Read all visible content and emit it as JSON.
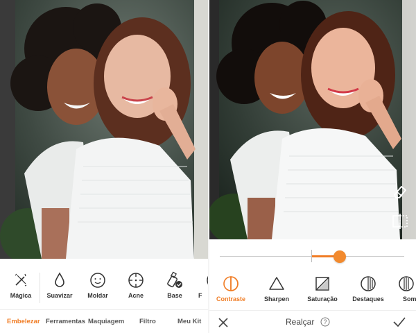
{
  "left_panel": {
    "tools": [
      {
        "label": "Mágica",
        "icon": "magic-wand-icon"
      },
      {
        "label": "Suavizar",
        "icon": "drop-icon"
      },
      {
        "label": "Moldar",
        "icon": "face-icon"
      },
      {
        "label": "Acne",
        "icon": "crosshair-icon"
      },
      {
        "label": "Base",
        "icon": "foundation-bottle-icon"
      },
      {
        "label": "F",
        "icon": "partial-tool-icon"
      }
    ],
    "nav_tabs": [
      {
        "label": "Embelezar",
        "active": true
      },
      {
        "label": "Ferramentas",
        "active": false
      },
      {
        "label": "Maquiagem",
        "active": false
      },
      {
        "label": "Filtro",
        "active": false
      },
      {
        "label": "Meu Kit",
        "active": false
      }
    ]
  },
  "right_panel": {
    "slider": {
      "min": -100,
      "max": 100,
      "value": 30
    },
    "adjustments": [
      {
        "label": "Contraste",
        "icon": "contrast-icon",
        "active": true
      },
      {
        "label": "Sharpen",
        "icon": "triangle-icon",
        "active": false
      },
      {
        "label": "Saturação",
        "icon": "saturation-icon",
        "active": false
      },
      {
        "label": "Destaques",
        "icon": "highlights-icon",
        "active": false
      },
      {
        "label": "Som",
        "icon": "shadows-icon",
        "active": false
      }
    ],
    "action_bar": {
      "title": "Realçar"
    }
  },
  "colors": {
    "accent": "#f07c24",
    "text": "#333333",
    "muted": "#555555"
  }
}
